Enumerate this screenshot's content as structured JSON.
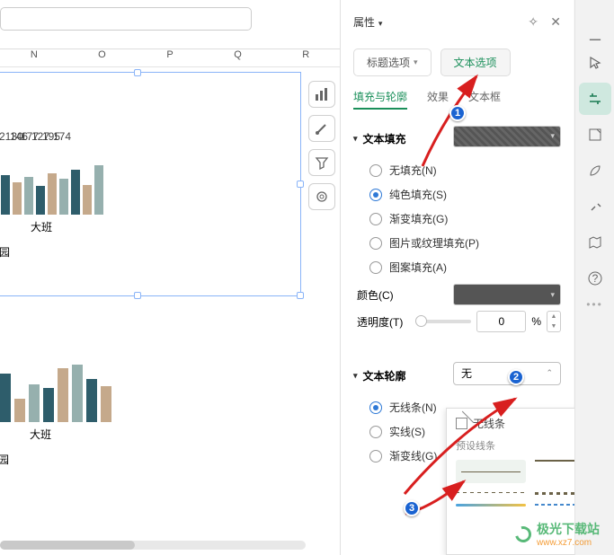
{
  "cols": [
    "N",
    "O",
    "P",
    "Q",
    "R"
  ],
  "chart_data": [
    {
      "type": "bar",
      "title": "",
      "categories_shown": [
        "大班"
      ],
      "school_label": "幼儿园",
      "values": [
        2130,
        146,
        177,
        127,
        195,
        174
      ],
      "series_colors": [
        "#2e5d6b",
        "#c5a98b",
        "#96b0ae"
      ]
    },
    {
      "type": "bar",
      "categories_shown": [
        "大班"
      ],
      "school_label": "幼儿园",
      "series_colors": [
        "#2e5d6b",
        "#c5a98b",
        "#96b0ae"
      ]
    }
  ],
  "tools": {
    "chart": "chart-icon",
    "brush": "brush-icon",
    "filter": "filter-icon",
    "gear": "gear-icon"
  },
  "panel": {
    "title": "属性",
    "tab_title": "标题选项",
    "tab_text": "文本选项",
    "sub_fill": "填充与轮廓",
    "sub_effect": "效果",
    "sub_box": "文本框",
    "sec_fill": "文本填充",
    "fill_none": "无填充(N)",
    "fill_solid": "纯色填充(S)",
    "fill_grad": "渐变填充(G)",
    "fill_pic": "图片或纹理填充(P)",
    "fill_pat": "图案填充(A)",
    "color_label": "颜色(C)",
    "opacity_label": "透明度(T)",
    "opacity_value": "0",
    "opacity_unit": "%",
    "sec_outline": "文本轮廓",
    "outline_value": "无",
    "ol_none": "无线条(N)",
    "ol_solid": "实线(S)",
    "ol_grad": "渐变线(G)"
  },
  "flyout": {
    "none": "无线条",
    "preset": "预设线条"
  },
  "badges": {
    "b1": "1",
    "b2": "2",
    "b3": "3"
  },
  "watermark": {
    "name": "极光下载站",
    "url": "www.xz7.com"
  }
}
